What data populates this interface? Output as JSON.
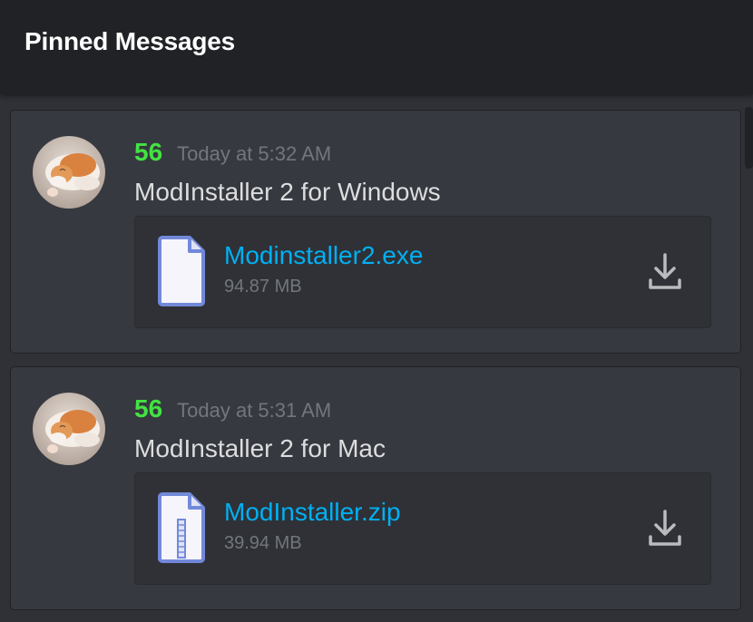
{
  "header": {
    "title": "Pinned Messages"
  },
  "colors": {
    "username": "#43e243",
    "link": "#00b0f4",
    "muted": "#72767d",
    "text": "#dcddde",
    "header_bg": "#202225",
    "card_bg": "#36393f"
  },
  "messages": [
    {
      "author": "56",
      "timestamp": "Today at 5:32 AM",
      "content": "ModInstaller 2 for Windows",
      "avatar_icon": "cat-avatar",
      "attachment": {
        "filename": "Modinstaller2.exe",
        "size": "94.87 MB",
        "file_icon": "document-file-icon",
        "action_icon": "download-icon"
      }
    },
    {
      "author": "56",
      "timestamp": "Today at 5:31 AM",
      "content": "ModInstaller 2 for Mac",
      "avatar_icon": "cat-avatar",
      "attachment": {
        "filename": "ModInstaller.zip",
        "size": "39.94 MB",
        "file_icon": "archive-file-icon",
        "action_icon": "download-icon"
      }
    }
  ]
}
